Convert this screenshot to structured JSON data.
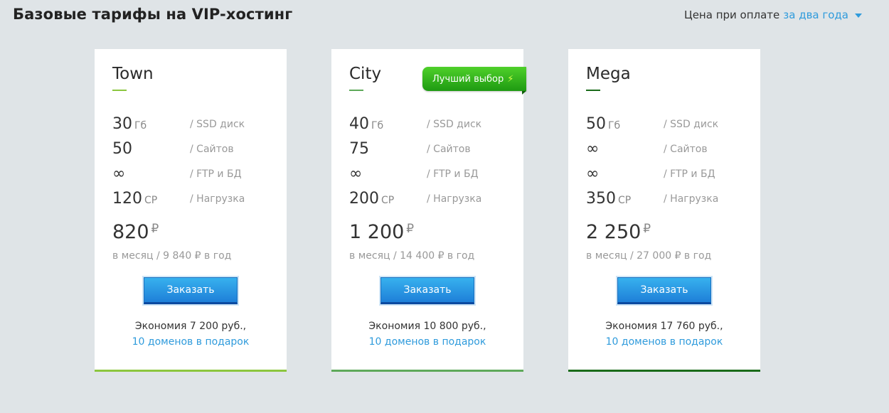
{
  "header": {
    "title": "Базовые тарифы на VIP-хостинг",
    "period_prefix": "Цена при оплате",
    "period_value": "за два года"
  },
  "badge": {
    "label": "Лучший выбор"
  },
  "order_label": "Заказать",
  "colors": {
    "accent": "#2f9bdc",
    "town": "#8cc63f",
    "city": "#5ea95a",
    "mega": "#1a6b1a"
  },
  "plans": [
    {
      "name": "Town",
      "specs": [
        {
          "value": "30",
          "unit": "Гб",
          "label": "/ SSD диск"
        },
        {
          "value": "50",
          "unit": "",
          "label": "/ Сайтов"
        },
        {
          "value": "∞",
          "unit": "",
          "label": "/ FTP и БД"
        },
        {
          "value": "120",
          "unit": "CP",
          "label": "/ Нагрузка"
        }
      ],
      "price": "820",
      "currency": "₽",
      "price_sub": "в месяц / 9 840 ₽ в год",
      "economy": "Экономия 7 200 руб.,",
      "gift": "10 доменов в подарок"
    },
    {
      "name": "City",
      "specs": [
        {
          "value": "40",
          "unit": "Гб",
          "label": "/ SSD диск"
        },
        {
          "value": "75",
          "unit": "",
          "label": "/ Сайтов"
        },
        {
          "value": "∞",
          "unit": "",
          "label": "/ FTP и БД"
        },
        {
          "value": "200",
          "unit": "CP",
          "label": "/ Нагрузка"
        }
      ],
      "price": "1 200",
      "currency": "₽",
      "price_sub": "в месяц / 14 400 ₽ в год",
      "economy": "Экономия 10 800 руб.,",
      "gift": "10 доменов в подарок"
    },
    {
      "name": "Mega",
      "specs": [
        {
          "value": "50",
          "unit": "Гб",
          "label": "/ SSD диск"
        },
        {
          "value": "∞",
          "unit": "",
          "label": "/ Сайтов"
        },
        {
          "value": "∞",
          "unit": "",
          "label": "/ FTP и БД"
        },
        {
          "value": "350",
          "unit": "CP",
          "label": "/ Нагрузка"
        }
      ],
      "price": "2 250",
      "currency": "₽",
      "price_sub": "в месяц / 27 000 ₽ в год",
      "economy": "Экономия 17 760 руб.,",
      "gift": "10 доменов в подарок"
    }
  ]
}
